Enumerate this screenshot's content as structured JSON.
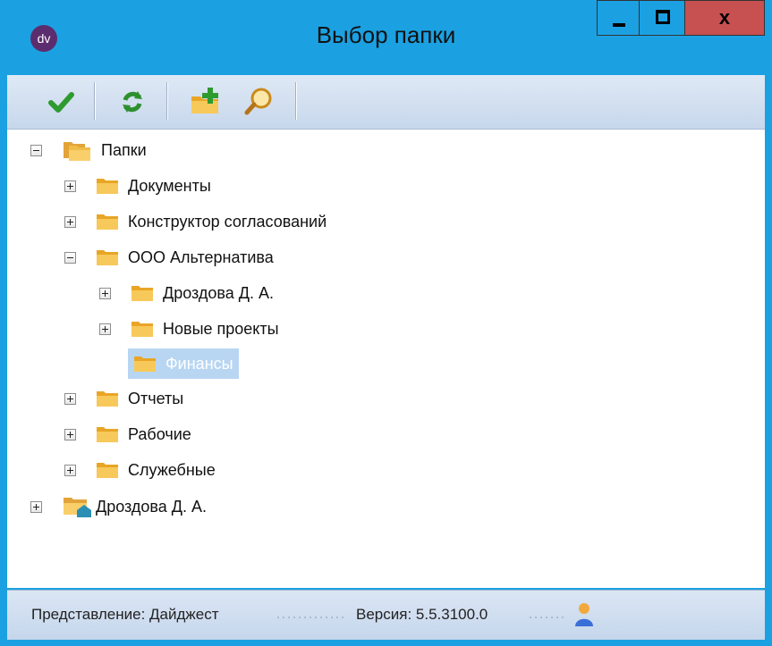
{
  "window": {
    "title": "Выбор папки",
    "app_icon_text": "dv",
    "close_label": "x"
  },
  "toolbar": {
    "buttons": [
      {
        "name": "ok",
        "icon": "checkmark-icon"
      },
      {
        "name": "refresh",
        "icon": "refresh-icon"
      },
      {
        "name": "new-folder",
        "icon": "new-folder-icon"
      },
      {
        "name": "find",
        "icon": "search-icon"
      }
    ]
  },
  "tree": {
    "root": "Папки",
    "items": [
      {
        "label": "Документы"
      },
      {
        "label": "Конструктор согласований"
      },
      {
        "label": "ООО Альтернатива"
      },
      {
        "label": "Дроздова Д. А."
      },
      {
        "label": "Новые проекты"
      },
      {
        "label": "Финансы",
        "selected": true
      },
      {
        "label": "Отчеты"
      },
      {
        "label": "Рабочие"
      },
      {
        "label": "Служебные"
      }
    ],
    "personal_root": "Дроздова Д. А."
  },
  "status": {
    "view": "Представление: Дайджест",
    "version": "Версия: 5.5.3100.0"
  },
  "colors": {
    "titlebar": "#1ba1e2",
    "close": "#c75050",
    "selection": "#b8d6f2",
    "folder": "#f4b93a"
  }
}
